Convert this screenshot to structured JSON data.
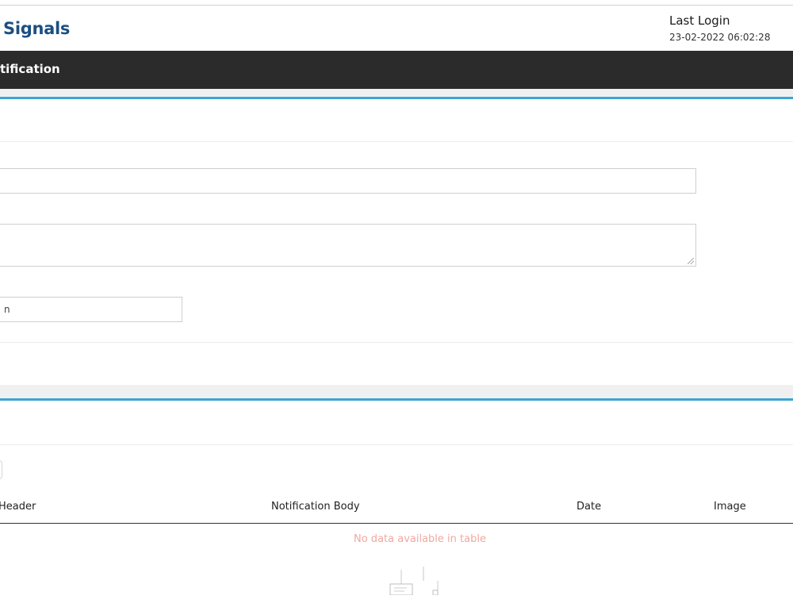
{
  "header": {
    "brand": "Signals",
    "last_login_label": "Last Login",
    "last_login_value": "23-02-2022 06:02:28"
  },
  "nav": {
    "title": "tification"
  },
  "form": {
    "field_short_value": "n"
  },
  "table": {
    "columns": [
      "Header",
      "Notification Body",
      "Date",
      "Image"
    ],
    "empty_message": "No data available in table"
  }
}
